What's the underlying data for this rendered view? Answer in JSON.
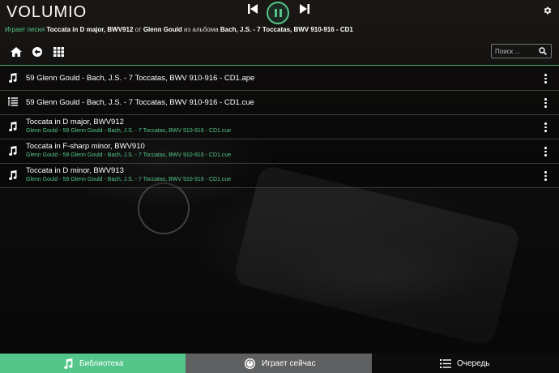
{
  "app": {
    "logo": "VOLUMIO"
  },
  "player": {
    "now_prefix": "Играет песня",
    "track": "Toccata in D major, BWV912",
    "by": "от",
    "artist": "Glenn Gould",
    "from_album": "из альбома",
    "album": "Bach, J.S. - 7 Toccatas, BWV 910-916 - CD1",
    "state": "playing"
  },
  "search": {
    "placeholder": "Поиск ..."
  },
  "list": {
    "items": [
      {
        "icon": "music-note-icon",
        "title": "59 Glenn Gould - Bach, J.S. - 7 Toccatas, BWV 910-916 - CD1.ape",
        "subtitle": ""
      },
      {
        "icon": "playlist-icon",
        "title": "59 Glenn Gould - Bach, J.S. - 7 Toccatas, BWV 910-916 - CD1.cue",
        "subtitle": ""
      },
      {
        "icon": "music-note-icon",
        "title": "Toccata in D major, BWV912",
        "subtitle": "Glenn Gould - 59 Glenn Gould - Bach, J.S. - 7 Toccatas, BWV 910-916 - CD1.cue"
      },
      {
        "icon": "music-note-icon",
        "title": "Toccata in F-sharp minor, BWV910",
        "subtitle": "Glenn Gould - 59 Glenn Gould - Bach, J.S. - 7 Toccatas, BWV 910-916 - CD1.cue"
      },
      {
        "icon": "music-note-icon",
        "title": "Toccata in D minor, BWV913",
        "subtitle": "Glenn Gould - 59 Glenn Gould - Bach, J.S. - 7 Toccatas, BWV 910-916 - CD1.cue"
      }
    ]
  },
  "tabs": {
    "library": "Библиотека",
    "playing": "Играет сейчас",
    "queue": "Очередь"
  },
  "colors": {
    "accent": "#54c689",
    "tab_gray": "#5e6061",
    "dark": "#0c0c0c"
  }
}
